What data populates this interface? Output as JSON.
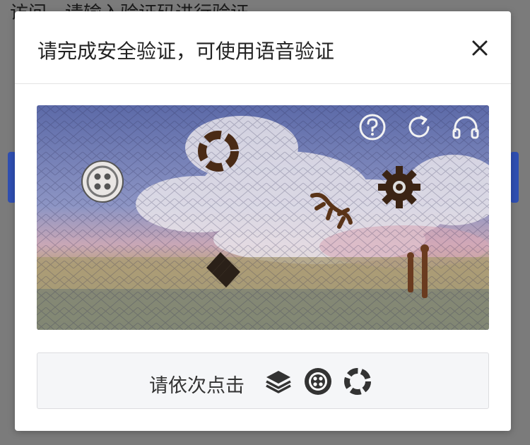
{
  "background": {
    "prompt_text": "访问，请输入验证码进行验证"
  },
  "dialog": {
    "title": "请完成安全验证，可使用语音验证",
    "close_icon": "close-icon"
  },
  "captcha": {
    "toolbar": [
      {
        "icon": "help-icon"
      },
      {
        "icon": "refresh-icon"
      },
      {
        "icon": "headphones-icon"
      }
    ],
    "targets": [
      {
        "icon": "ring-icon"
      },
      {
        "icon": "button-icon"
      },
      {
        "icon": "gear-icon"
      },
      {
        "icon": "lizard-icon"
      },
      {
        "icon": "layers-icon"
      }
    ]
  },
  "instruction": {
    "text": "请依次点击",
    "sequence": [
      "layers-icon",
      "button-icon",
      "ring-icon"
    ]
  }
}
